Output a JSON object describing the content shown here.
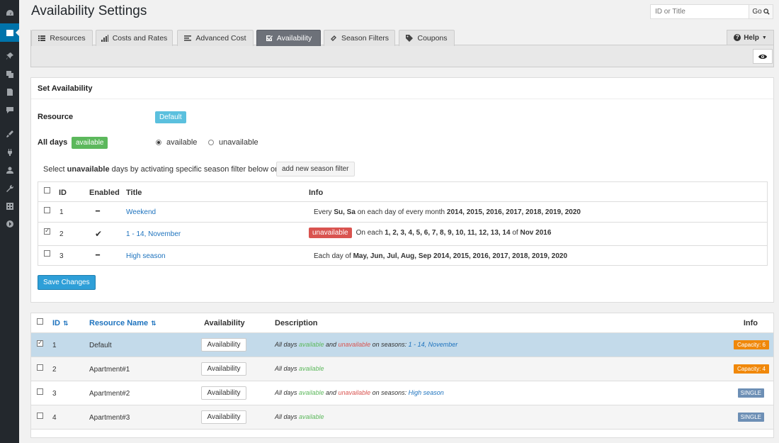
{
  "page": {
    "title": "Availability Settings"
  },
  "search": {
    "placeholder": "ID or Title",
    "go_label": "Go"
  },
  "tabs": [
    {
      "label": "Resources",
      "icon": "list-icon"
    },
    {
      "label": "Costs and Rates",
      "icon": "bar-chart-icon"
    },
    {
      "label": "Advanced Cost",
      "icon": "align-icon"
    },
    {
      "label": "Availability",
      "icon": "check-square-icon",
      "active": true
    },
    {
      "label": "Season Filters",
      "icon": "link-icon"
    },
    {
      "label": "Coupons",
      "icon": "tag-icon"
    }
  ],
  "help": {
    "label": "Help"
  },
  "set_availability": {
    "heading": "Set Availability",
    "resource_label": "Resource",
    "resource_value": "Default",
    "all_days_label": "All days",
    "all_days_badge": "available",
    "radio_available": "available",
    "radio_unavailable": "unavailable",
    "select_prefix": "Select ",
    "select_bold": "unavailable",
    "select_suffix": " days by activating specific season filter below or",
    "add_filter_label": "add new season filter",
    "save_label": "Save Changes"
  },
  "season_table": {
    "headers": {
      "id": "ID",
      "enabled": "Enabled",
      "title": "Title",
      "info": "Info"
    },
    "rows": [
      {
        "id": "1",
        "enabled": "━",
        "title": "Weekend",
        "checked": false,
        "info_parts": [
          "Every ",
          "Su, Sa",
          " on each day of every month ",
          "2014, 2015, 2016, 2017, 2018, 2019, 2020"
        ]
      },
      {
        "id": "2",
        "enabled": "✔",
        "title": "1 - 14, November",
        "checked": true,
        "badge": "unavailable",
        "info_parts": [
          "On each ",
          "1, 2, 3, 4, 5, 6, 7, 8, 9, 10, 11, 12, 13, 14",
          " of ",
          "Nov 2016"
        ]
      },
      {
        "id": "3",
        "enabled": "━",
        "title": "High season",
        "checked": false,
        "info_parts": [
          "Each day of ",
          "May, Jun, Jul, Aug, Sep 2014, 2015, 2016, 2017, 2018, 2019, 2020"
        ]
      }
    ]
  },
  "resource_table": {
    "headers": {
      "id": "ID",
      "name": "Resource Name",
      "availability": "Availability",
      "description": "Description",
      "info": "Info"
    },
    "button_label": "Availability",
    "rows": [
      {
        "id": "1",
        "name": "Default",
        "checked": true,
        "desc": [
          "All days ",
          "available",
          " and ",
          "unavailable",
          " on seasons: ",
          "1 - 14, November"
        ],
        "info": "Capacity:  6",
        "info_type": "capacity"
      },
      {
        "id": "2",
        "name": "Apartment#1",
        "checked": false,
        "desc": [
          "All days ",
          "available"
        ],
        "info": "Capacity:  4",
        "info_type": "capacity"
      },
      {
        "id": "3",
        "name": "Apartment#2",
        "checked": false,
        "desc": [
          "All days ",
          "available",
          " and ",
          "unavailable",
          " on seasons: ",
          "High season"
        ],
        "info": "SINGLE",
        "info_type": "single"
      },
      {
        "id": "4",
        "name": "Apartment#3",
        "checked": false,
        "desc": [
          "All days ",
          "available"
        ],
        "info": "SINGLE",
        "info_type": "single"
      }
    ]
  }
}
